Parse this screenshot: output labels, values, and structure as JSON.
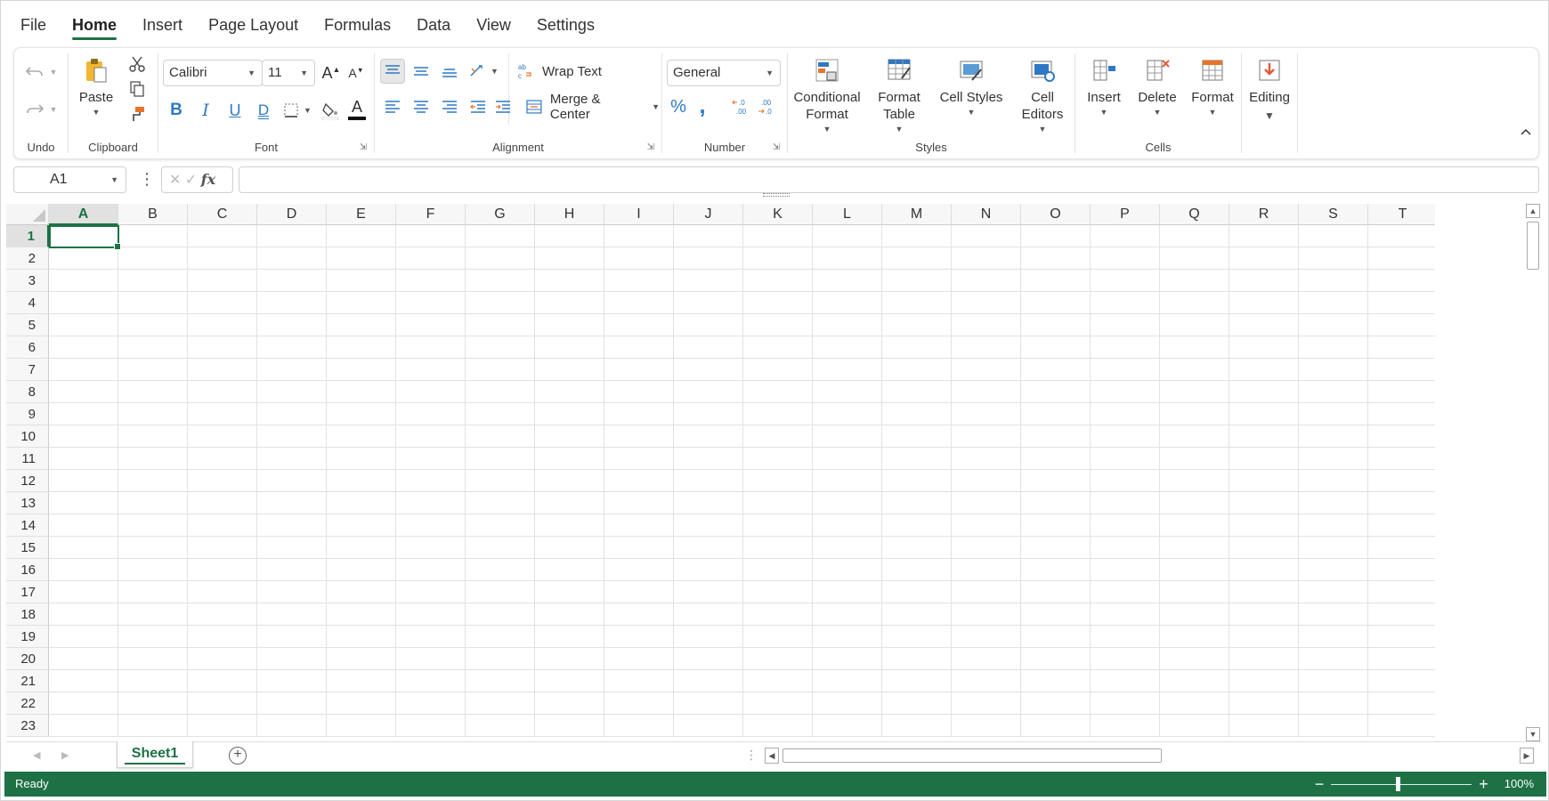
{
  "menu": {
    "tabs": [
      "File",
      "Home",
      "Insert",
      "Page Layout",
      "Formulas",
      "Data",
      "View",
      "Settings"
    ],
    "active": "Home"
  },
  "ribbon": {
    "undo": {
      "label": "Undo"
    },
    "clipboard": {
      "label": "Clipboard",
      "paste": "Paste"
    },
    "font": {
      "label": "Font",
      "name": "Calibri",
      "size": "11",
      "bold": "B",
      "italic": "I",
      "underline": "U",
      "double_underline": "D",
      "font_color": "A"
    },
    "alignment": {
      "label": "Alignment",
      "wrap_text": "Wrap Text",
      "merge_center": "Merge & Center"
    },
    "number": {
      "label": "Number",
      "format": "General",
      "percent": "%",
      "comma": ","
    },
    "styles": {
      "label": "Styles",
      "conditional_format_1": "Conditional",
      "conditional_format_2": "Format",
      "format_table_1": "Format",
      "format_table_2": "Table",
      "cell_styles": "Cell Styles",
      "cell_editors": "Cell Editors"
    },
    "cells": {
      "label": "Cells",
      "insert": "Insert",
      "delete": "Delete",
      "format": "Format"
    },
    "editing": {
      "label": "Editing"
    }
  },
  "formula_bar": {
    "name_box": "A1",
    "fx": "fx",
    "formula": ""
  },
  "grid": {
    "columns": [
      "A",
      "B",
      "C",
      "D",
      "E",
      "F",
      "G",
      "H",
      "I",
      "J",
      "K",
      "L",
      "M",
      "N",
      "O",
      "P",
      "Q",
      "R",
      "S",
      "T"
    ],
    "rows": [
      "1",
      "2",
      "3",
      "4",
      "5",
      "6",
      "7",
      "8",
      "9",
      "10",
      "11",
      "12",
      "13",
      "14",
      "15",
      "16",
      "17",
      "18",
      "19",
      "20",
      "21",
      "22",
      "23"
    ],
    "active_cell": "A1"
  },
  "sheets": {
    "tabs": [
      "Sheet1"
    ],
    "active": "Sheet1"
  },
  "status": {
    "text": "Ready",
    "zoom": "100%"
  },
  "colors": {
    "accent": "#1e7145",
    "blue_icon": "#2f78c4",
    "orange_icon": "#e8742a"
  }
}
